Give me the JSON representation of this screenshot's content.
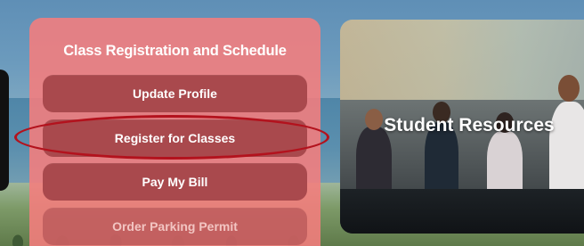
{
  "registration_panel": {
    "title": "Class Registration and Schedule",
    "buttons": [
      {
        "label": "Update Profile"
      },
      {
        "label": "Register for Classes"
      },
      {
        "label": "Pay My Bill"
      },
      {
        "label": "Order Parking Permit"
      }
    ]
  },
  "resources_card": {
    "title": "Student Resources"
  },
  "colors": {
    "panel_background": "#f57d7d",
    "button_background": "#a9494d",
    "highlight_ring": "#b3121d",
    "text": "#ffffff"
  }
}
